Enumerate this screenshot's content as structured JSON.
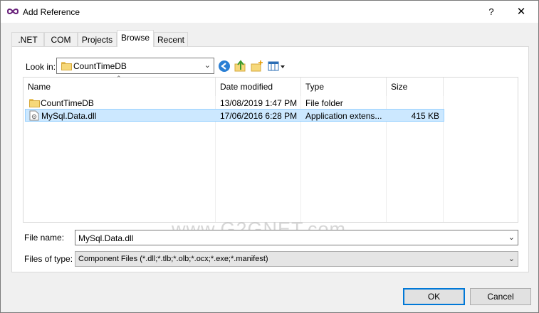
{
  "window": {
    "title": "Add Reference",
    "help_glyph": "?",
    "close_glyph": "✕"
  },
  "tabs": [
    {
      "label": ".NET"
    },
    {
      "label": "COM"
    },
    {
      "label": "Projects"
    },
    {
      "label": "Browse"
    },
    {
      "label": "Recent"
    }
  ],
  "active_tab": "Browse",
  "look_in": {
    "label": "Look in:",
    "value": "CountTimeDB"
  },
  "toolbar_icons": [
    "back-icon",
    "up-folder-icon",
    "new-folder-icon",
    "view-menu-icon"
  ],
  "file_list": {
    "columns": [
      "Name",
      "Date modified",
      "Type",
      "Size"
    ],
    "rows": [
      {
        "icon": "folder-icon",
        "name": "CountTimeDB",
        "date": "13/08/2019 1:47 PM",
        "type": "File folder",
        "size": "",
        "selected": false
      },
      {
        "icon": "dll-file-icon",
        "name": "MySql.Data.dll",
        "date": "17/06/2016 6:28 PM",
        "type": "Application extens...",
        "size": "415 KB",
        "selected": true
      }
    ]
  },
  "file_name": {
    "label": "File name:",
    "value": "MySql.Data.dll"
  },
  "files_of_type": {
    "label": "Files of type:",
    "value": "Component Files (*.dll;*.tlb;*.olb;*.ocx;*.exe;*.manifest)"
  },
  "watermark": "www.G2GNET.com",
  "buttons": {
    "ok": "OK",
    "cancel": "Cancel"
  },
  "colors": {
    "selection": "#cce8ff",
    "accent": "#0078d7"
  }
}
